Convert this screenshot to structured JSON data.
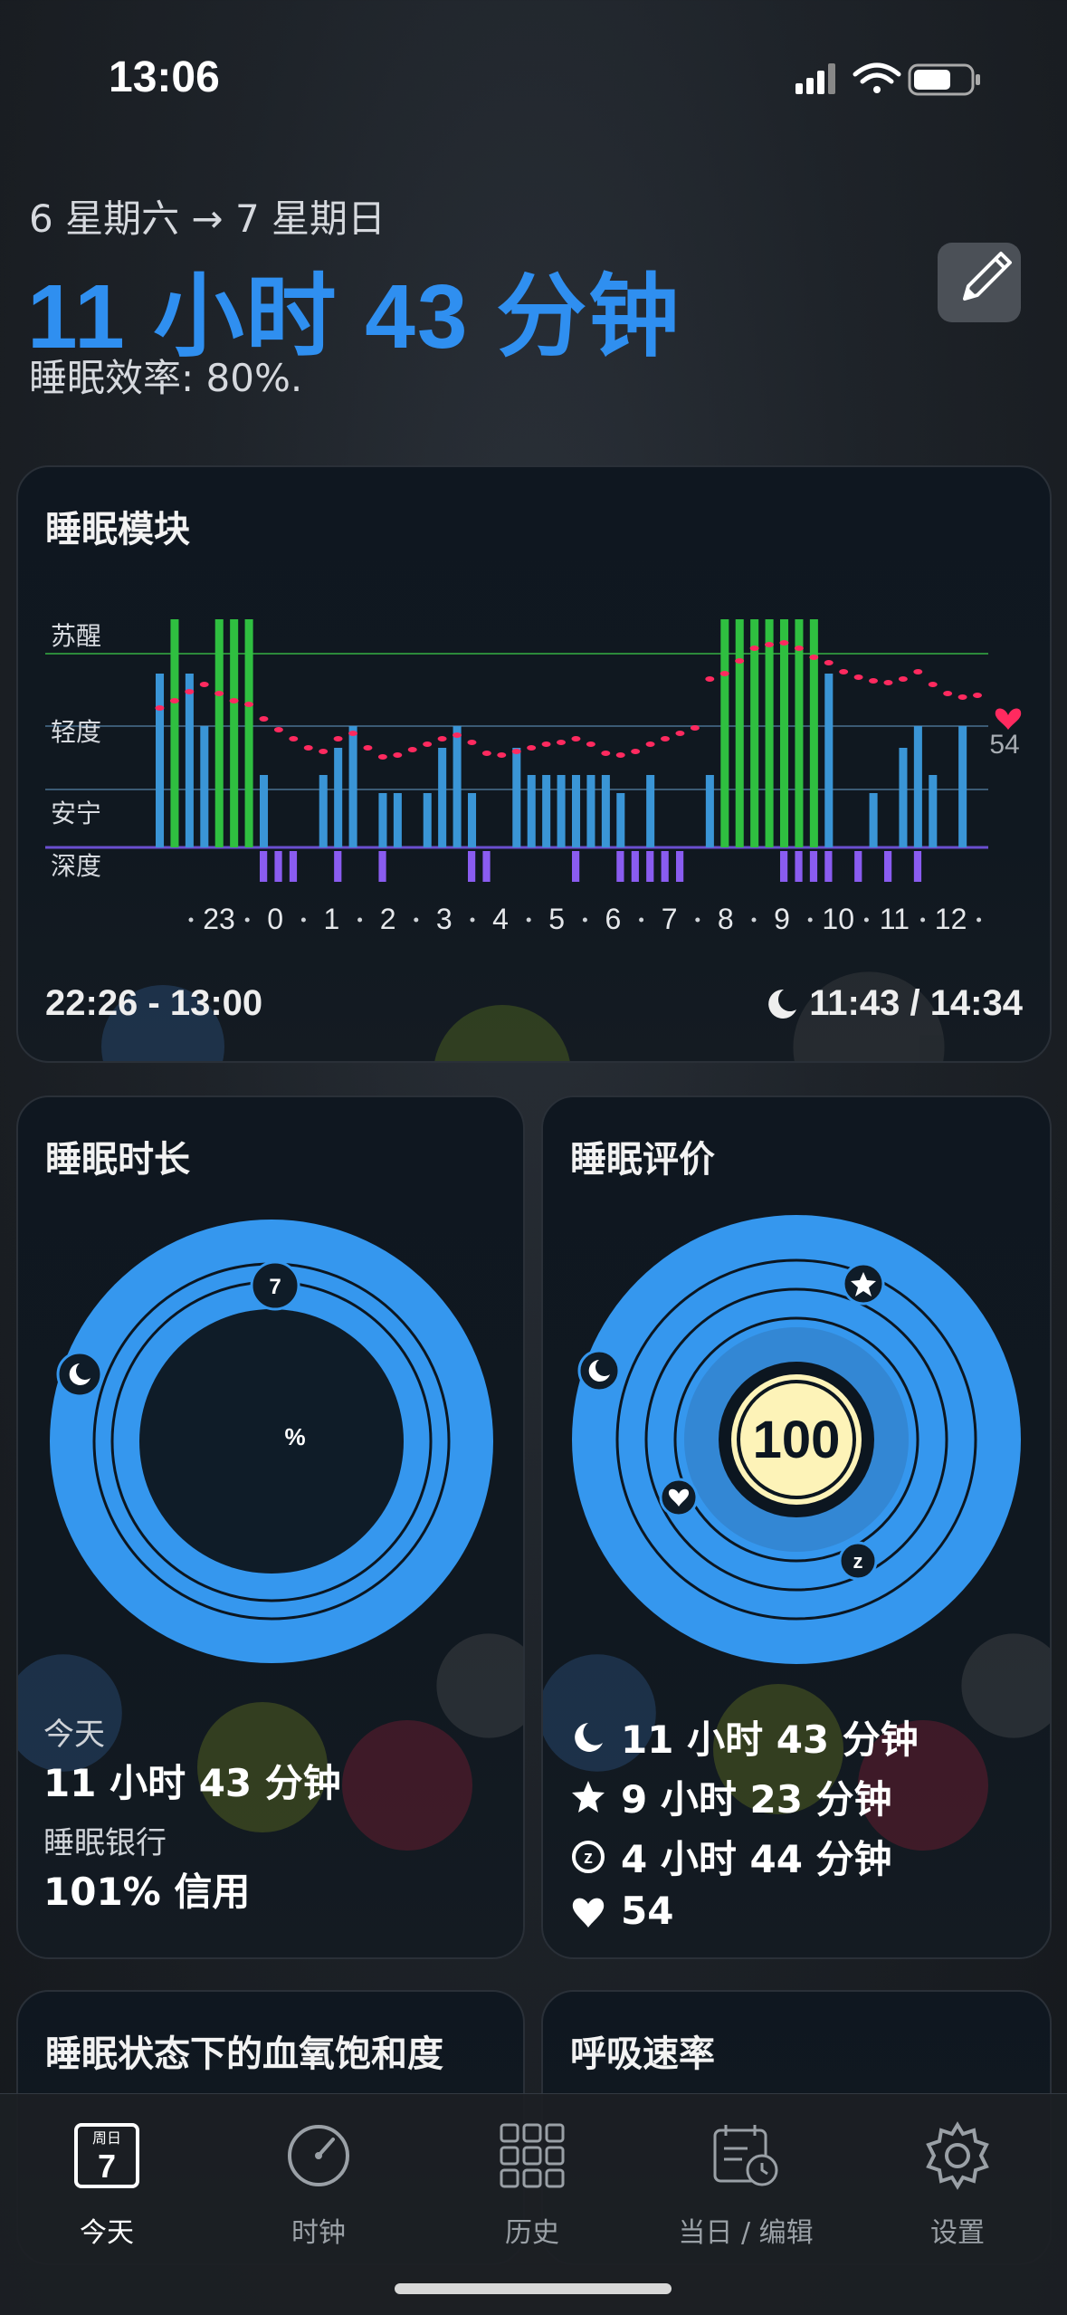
{
  "status_bar": {
    "time": "13:06",
    "icons": [
      "cellular-icon",
      "wifi-icon",
      "battery-icon"
    ]
  },
  "header": {
    "date_range": "6 星期六 → 7 星期日",
    "duration": "11 小时 43 分钟",
    "efficiency": "睡眠效率: 80%.",
    "edit_icon": "pencil-icon"
  },
  "sleep_module": {
    "title": "睡眠模块",
    "stage_labels": [
      "苏醒",
      "轻度",
      "安宁",
      "深度"
    ],
    "hour_ticks": [
      "23",
      "0",
      "1",
      "2",
      "3",
      "4",
      "5",
      "6",
      "7",
      "8",
      "9",
      "10",
      "11",
      "12"
    ],
    "heart_rate": "54",
    "time_range": "22:26 - 13:00",
    "sleep_ratio": "11:43 / 14:34"
  },
  "chart_data": {
    "type": "bar",
    "title": "睡眠模块",
    "stages": [
      "苏醒",
      "轻度",
      "安宁",
      "深度"
    ],
    "x": [
      "23",
      "0",
      "1",
      "2",
      "3",
      "4",
      "5",
      "6",
      "7",
      "8",
      "9",
      "10",
      "11",
      "12"
    ],
    "bars": [
      {
        "slot": 0,
        "level": "light-high",
        "color": "blue"
      },
      {
        "slot": 1,
        "level": "awake",
        "color": "green"
      },
      {
        "slot": 2,
        "level": "light-high",
        "color": "blue"
      },
      {
        "slot": 3,
        "level": "light",
        "color": "blue"
      },
      {
        "slot": 4,
        "level": "awake",
        "color": "green"
      },
      {
        "slot": 5,
        "level": "awake",
        "color": "green"
      },
      {
        "slot": 6,
        "level": "awake",
        "color": "green"
      },
      {
        "slot": 7,
        "level": "calm",
        "color": "blue"
      },
      {
        "slot": 11,
        "level": "calm",
        "color": "blue"
      },
      {
        "slot": 12,
        "level": "light-low",
        "color": "blue"
      },
      {
        "slot": 13,
        "level": "light",
        "color": "blue"
      },
      {
        "slot": 15,
        "level": "calm-low",
        "color": "blue"
      },
      {
        "slot": 16,
        "level": "calm-low",
        "color": "blue"
      },
      {
        "slot": 18,
        "level": "calm-low",
        "color": "blue"
      },
      {
        "slot": 19,
        "level": "light-low",
        "color": "blue"
      },
      {
        "slot": 20,
        "level": "light",
        "color": "blue"
      },
      {
        "slot": 21,
        "level": "calm-low",
        "color": "blue"
      },
      {
        "slot": 24,
        "level": "light-low",
        "color": "blue"
      },
      {
        "slot": 25,
        "level": "calm",
        "color": "blue"
      },
      {
        "slot": 26,
        "level": "calm",
        "color": "blue"
      },
      {
        "slot": 27,
        "level": "calm",
        "color": "blue"
      },
      {
        "slot": 28,
        "level": "calm",
        "color": "blue"
      },
      {
        "slot": 29,
        "level": "calm",
        "color": "blue"
      },
      {
        "slot": 30,
        "level": "calm",
        "color": "blue"
      },
      {
        "slot": 31,
        "level": "calm-low",
        "color": "blue"
      },
      {
        "slot": 33,
        "level": "calm",
        "color": "blue"
      },
      {
        "slot": 37,
        "level": "calm",
        "color": "blue"
      },
      {
        "slot": 38,
        "level": "awake",
        "color": "green"
      },
      {
        "slot": 39,
        "level": "awake",
        "color": "green"
      },
      {
        "slot": 40,
        "level": "awake",
        "color": "green"
      },
      {
        "slot": 41,
        "level": "awake",
        "color": "green"
      },
      {
        "slot": 42,
        "level": "awake",
        "color": "green"
      },
      {
        "slot": 43,
        "level": "awake",
        "color": "green"
      },
      {
        "slot": 44,
        "level": "awake",
        "color": "green"
      },
      {
        "slot": 45,
        "level": "light-high",
        "color": "blue"
      },
      {
        "slot": 48,
        "level": "calm-low",
        "color": "blue"
      },
      {
        "slot": 50,
        "level": "light-low",
        "color": "blue"
      },
      {
        "slot": 51,
        "level": "light",
        "color": "blue"
      },
      {
        "slot": 52,
        "level": "calm",
        "color": "blue"
      },
      {
        "slot": 54,
        "level": "light",
        "color": "blue"
      }
    ],
    "deep_slots": [
      7,
      8,
      9,
      12,
      15,
      21,
      22,
      28,
      31,
      32,
      33,
      34,
      35,
      42,
      43,
      44,
      45,
      47,
      49,
      51
    ],
    "heart_rate_current": 54,
    "colors": {
      "awake": "#2fbf40",
      "sleep": "#3a95d6",
      "deep": "#8a5cf0",
      "heart_rate": "#ff2a5f"
    }
  },
  "duration_card": {
    "title": "睡眠时长",
    "badge": "7",
    "center_symbol": "%",
    "today_label": "今天",
    "today_value": "11 小时 43 分钟",
    "bank_label": "睡眠银行",
    "bank_value": "101% 信用"
  },
  "rating_card": {
    "title": "睡眠评价",
    "score": "100",
    "rows": [
      {
        "icon": "moon-icon",
        "value": "11 小时 43 分钟"
      },
      {
        "icon": "star-icon",
        "value": "9 小时 23 分钟"
      },
      {
        "icon": "z-icon",
        "value": "4 小时 44 分钟"
      },
      {
        "icon": "heart-icon",
        "value": "54"
      }
    ]
  },
  "spo2_card": {
    "title": "睡眠状态下的血氧饱和度"
  },
  "resp_card": {
    "title": "呼吸速率"
  },
  "tab_bar": {
    "calendar_weekday": "周日",
    "calendar_day": "7",
    "tabs": [
      {
        "label": "今天",
        "icon": "calendar-icon",
        "active": true
      },
      {
        "label": "时钟",
        "icon": "clock-icon",
        "active": false
      },
      {
        "label": "历史",
        "icon": "grid-icon",
        "active": false
      },
      {
        "label": "当日 / 编辑",
        "icon": "calendar-edit-icon",
        "active": false
      },
      {
        "label": "设置",
        "icon": "gear-icon",
        "active": false
      }
    ]
  }
}
